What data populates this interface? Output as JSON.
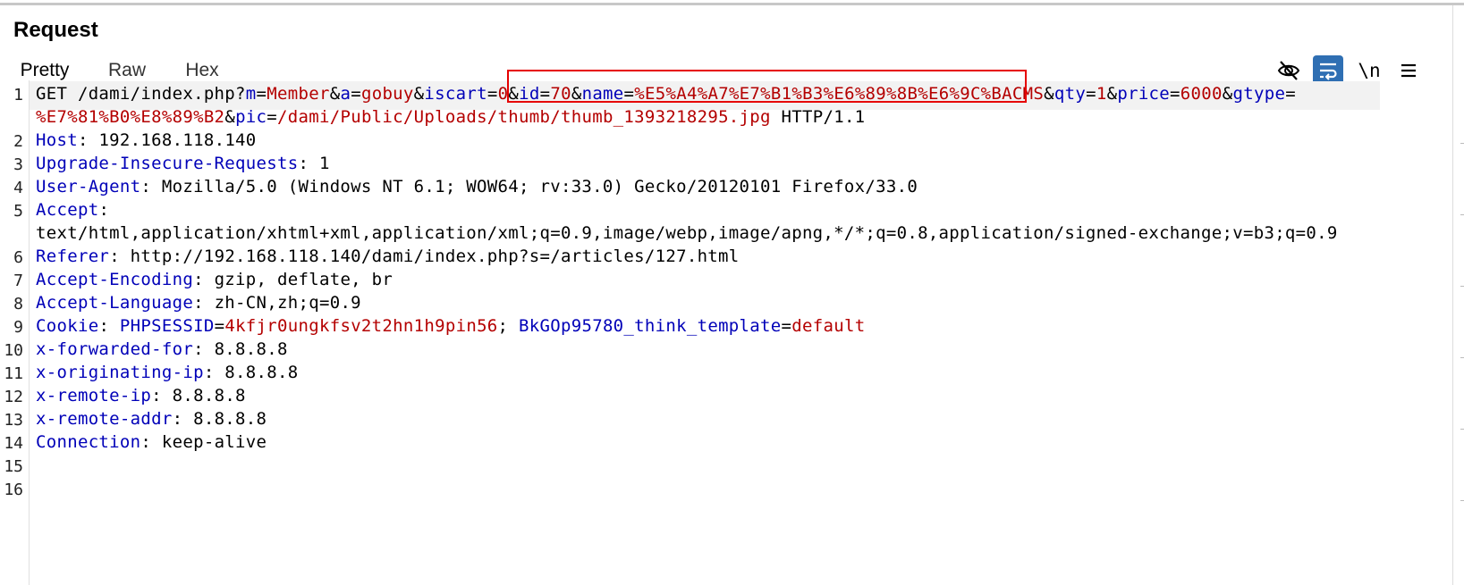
{
  "panel": {
    "title": "Request"
  },
  "tabs": [
    {
      "label": "Pretty",
      "active": true
    },
    {
      "label": "Raw",
      "active": false
    },
    {
      "label": "Hex",
      "active": false
    }
  ],
  "toolbar": {
    "hide_icon": "eye-slash-icon",
    "wrap_icon": "word-wrap-icon",
    "newline_label": "\\n",
    "menu_icon": "hamburger-menu-icon",
    "accent": "#2f6fb3",
    "tab_accent": "#f06a2b",
    "highlight_border": "#e60000"
  },
  "line_numbers": [
    "1",
    "2",
    "3",
    "4",
    "5",
    "6",
    "7",
    "8",
    "9",
    "10",
    "11",
    "12",
    "13",
    "14",
    "15",
    "16"
  ],
  "request": {
    "line1a": [
      {
        "t": "p",
        "s": "GET /dami/index.php?"
      },
      {
        "t": "k",
        "s": "m"
      },
      {
        "t": "p",
        "s": "="
      },
      {
        "t": "v",
        "s": "Member"
      },
      {
        "t": "p",
        "s": "&"
      },
      {
        "t": "k",
        "s": "a"
      },
      {
        "t": "p",
        "s": "="
      },
      {
        "t": "v",
        "s": "gobuy"
      },
      {
        "t": "p",
        "s": "&"
      },
      {
        "t": "k",
        "s": "iscart"
      },
      {
        "t": "p",
        "s": "="
      },
      {
        "t": "v",
        "s": "0"
      },
      {
        "t": "p",
        "s": "&"
      },
      {
        "t": "k",
        "s": "id"
      },
      {
        "t": "p",
        "s": "="
      },
      {
        "t": "v",
        "s": "70"
      },
      {
        "t": "p",
        "s": "&"
      },
      {
        "t": "k",
        "s": "name"
      },
      {
        "t": "p",
        "s": "="
      },
      {
        "t": "v",
        "s": "%E5%A4%A7%E7%B1%B3%E6%89%8B%E6%9C%BACMS"
      },
      {
        "t": "p",
        "s": "&"
      },
      {
        "t": "k",
        "s": "qty"
      },
      {
        "t": "p",
        "s": "="
      },
      {
        "t": "v",
        "s": "1"
      },
      {
        "t": "p",
        "s": "&"
      },
      {
        "t": "k",
        "s": "price"
      },
      {
        "t": "p",
        "s": "="
      },
      {
        "t": "v",
        "s": "6000"
      },
      {
        "t": "p",
        "s": "&"
      },
      {
        "t": "k",
        "s": "gtype"
      },
      {
        "t": "p",
        "s": "="
      }
    ],
    "line1b": [
      {
        "t": "v",
        "s": "%E7%81%B0%E8%89%B2"
      },
      {
        "t": "p",
        "s": "&"
      },
      {
        "t": "k",
        "s": "pic"
      },
      {
        "t": "p",
        "s": "="
      },
      {
        "t": "v",
        "s": "/dami/Public/Uploads/thumb/thumb_1393218295.jpg"
      },
      {
        "t": "p",
        "s": " HTTP/1.1"
      }
    ],
    "line2": [
      {
        "t": "k",
        "s": "Host"
      },
      {
        "t": "p",
        "s": ": 192.168.118.140"
      }
    ],
    "line3": [
      {
        "t": "k",
        "s": "Upgrade-Insecure-Requests"
      },
      {
        "t": "p",
        "s": ": 1"
      }
    ],
    "line4": [
      {
        "t": "k",
        "s": "User-Agent"
      },
      {
        "t": "p",
        "s": ": Mozilla/5.0 (Windows NT 6.1; WOW64; rv:33.0) Gecko/20120101 Firefox/33.0"
      }
    ],
    "line5a": [
      {
        "t": "k",
        "s": "Accept"
      },
      {
        "t": "p",
        "s": ":"
      }
    ],
    "line5b": [
      {
        "t": "p",
        "s": "text/html,application/xhtml+xml,application/xml;q=0.9,image/webp,image/apng,*/*;q=0.8,application/signed-exchange;v=b3;q=0.9"
      }
    ],
    "line6": [
      {
        "t": "k",
        "s": "Referer"
      },
      {
        "t": "p",
        "s": ": http://192.168.118.140/dami/index.php?s=/articles/127.html"
      }
    ],
    "line7": [
      {
        "t": "k",
        "s": "Accept-Encoding"
      },
      {
        "t": "p",
        "s": ": gzip, deflate, br"
      }
    ],
    "line8": [
      {
        "t": "k",
        "s": "Accept-Language"
      },
      {
        "t": "p",
        "s": ": zh-CN,zh;q=0.9"
      }
    ],
    "line9": [
      {
        "t": "k",
        "s": "Cookie"
      },
      {
        "t": "p",
        "s": ": "
      },
      {
        "t": "k",
        "s": "PHPSESSID"
      },
      {
        "t": "p",
        "s": "="
      },
      {
        "t": "v",
        "s": "4kfjr0ungkfsv2t2hn1h9pin56"
      },
      {
        "t": "p",
        "s": "; "
      },
      {
        "t": "k",
        "s": "BkGOp95780_think_template"
      },
      {
        "t": "p",
        "s": "="
      },
      {
        "t": "v",
        "s": "default"
      }
    ],
    "line10": [
      {
        "t": "k",
        "s": "x-forwarded-for"
      },
      {
        "t": "p",
        "s": ": 8.8.8.8"
      }
    ],
    "line11": [
      {
        "t": "k",
        "s": "x-originating-ip"
      },
      {
        "t": "p",
        "s": ": 8.8.8.8"
      }
    ],
    "line12": [
      {
        "t": "k",
        "s": "x-remote-ip"
      },
      {
        "t": "p",
        "s": ": 8.8.8.8"
      }
    ],
    "line13": [
      {
        "t": "k",
        "s": "x-remote-addr"
      },
      {
        "t": "p",
        "s": ": 8.8.8.8"
      }
    ],
    "line14": [
      {
        "t": "k",
        "s": "Connection"
      },
      {
        "t": "p",
        "s": ": keep-alive"
      }
    ]
  }
}
